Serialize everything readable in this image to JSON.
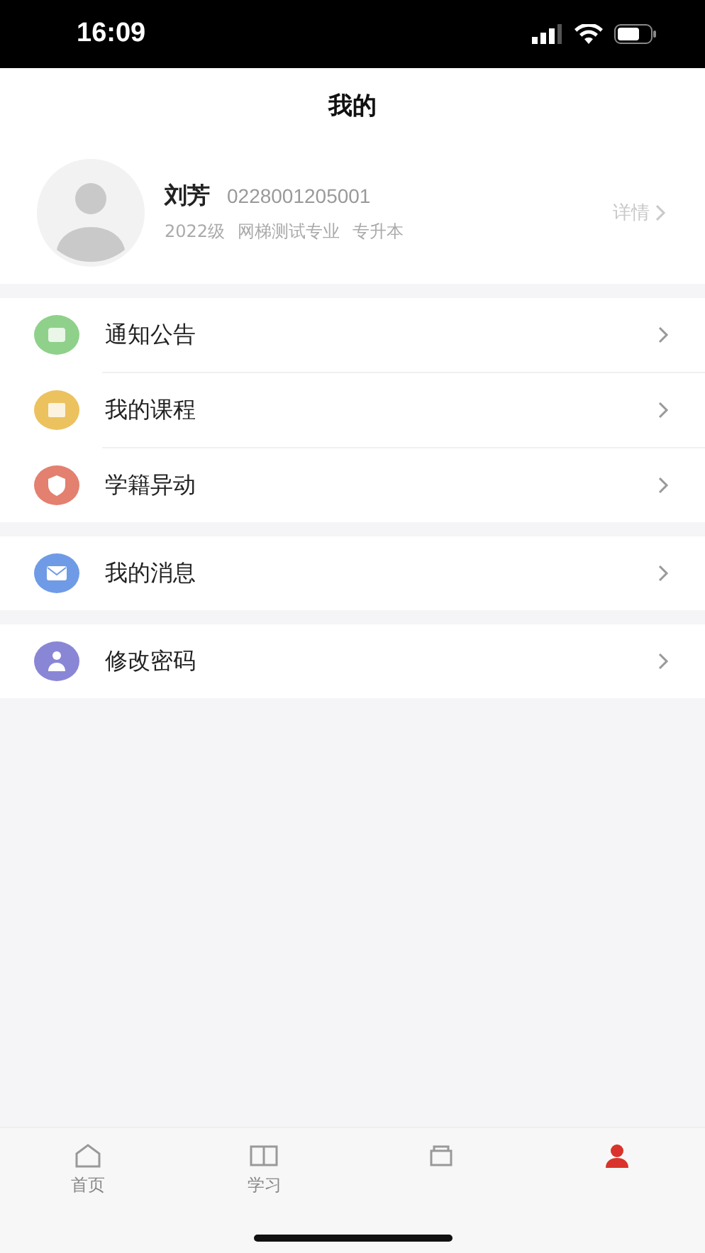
{
  "status_bar": {
    "time": "16:09"
  },
  "header": {
    "title": "我的"
  },
  "profile": {
    "name": "刘芳",
    "student_id": "0228001205001",
    "details": [
      "2022级",
      "网梯测试专业",
      "专升本"
    ],
    "link": "详情"
  },
  "menu_groups": [
    {
      "items": [
        {
          "label": "通知公告",
          "kind": "notice",
          "color": "#8fd18a"
        },
        {
          "label": "我的课程",
          "kind": "course",
          "color": "#ecc25e"
        },
        {
          "label": "学籍异动",
          "kind": "shield",
          "color": "#e3806f"
        }
      ]
    },
    {
      "items": [
        {
          "label": "我的消息",
          "kind": "mail",
          "color": "#6f9be6"
        }
      ]
    },
    {
      "items": [
        {
          "label": "修改密码",
          "kind": "user",
          "color": "#8a86d6"
        }
      ]
    }
  ],
  "tab_bar": [
    {
      "kind": "home",
      "label": "首页",
      "selected": false
    },
    {
      "kind": "book",
      "label": "学习",
      "selected": false
    },
    {
      "kind": "box",
      "selected": false
    },
    {
      "kind": "person",
      "selected": true
    }
  ]
}
